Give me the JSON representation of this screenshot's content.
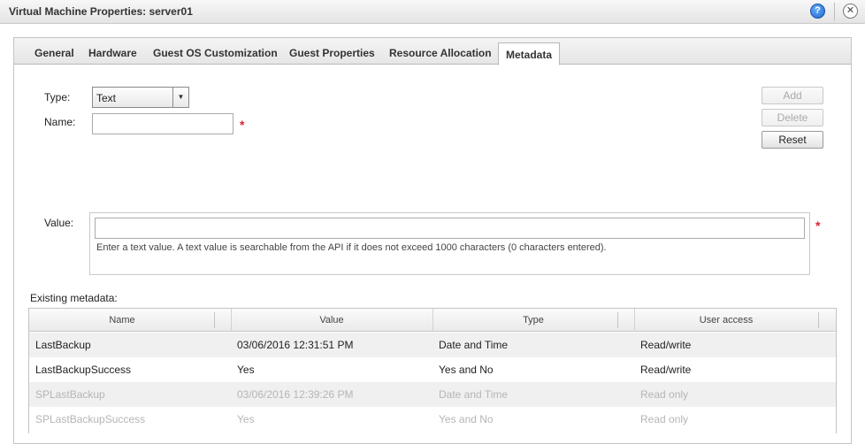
{
  "window": {
    "title": "Virtual Machine Properties: server01",
    "help_label": "?",
    "close_label": "✕"
  },
  "tabs": [
    {
      "label": "General"
    },
    {
      "label": "Hardware"
    },
    {
      "label": "Guest OS Customization"
    },
    {
      "label": "Guest Properties"
    },
    {
      "label": "Resource Allocation"
    },
    {
      "label": "Metadata"
    }
  ],
  "active_tab": "Metadata",
  "form": {
    "type_label": "Type:",
    "type_value": "Text",
    "name_label": "Name:",
    "name_value": "",
    "value_label": "Value:",
    "value_value": "",
    "required_mark": "*",
    "hint": "Enter a text value. A text value is searchable from the API if it does not exceed 1000 characters (0 characters entered)."
  },
  "buttons": {
    "add": "Add",
    "delete": "Delete",
    "reset": "Reset"
  },
  "existing": {
    "label": "Existing metadata:",
    "columns": [
      "Name",
      "Value",
      "Type",
      "User access"
    ],
    "rows": [
      {
        "name": "LastBackup",
        "value": "03/06/2016 12:31:51 PM",
        "type": "Date and Time",
        "access": "Read/write",
        "readonly": false
      },
      {
        "name": "LastBackupSuccess",
        "value": "Yes",
        "type": "Yes and No",
        "access": "Read/write",
        "readonly": false
      },
      {
        "name": "SPLastBackup",
        "value": "03/06/2016 12:39:26 PM",
        "type": "Date and Time",
        "access": "Read only",
        "readonly": true
      },
      {
        "name": "SPLastBackupSuccess",
        "value": "Yes",
        "type": "Yes and No",
        "access": "Read only",
        "readonly": true
      }
    ]
  },
  "colors": {
    "required": "#dd2233",
    "readonly_text": "#b5b5b5",
    "row_alt": "#f0f0f0"
  }
}
